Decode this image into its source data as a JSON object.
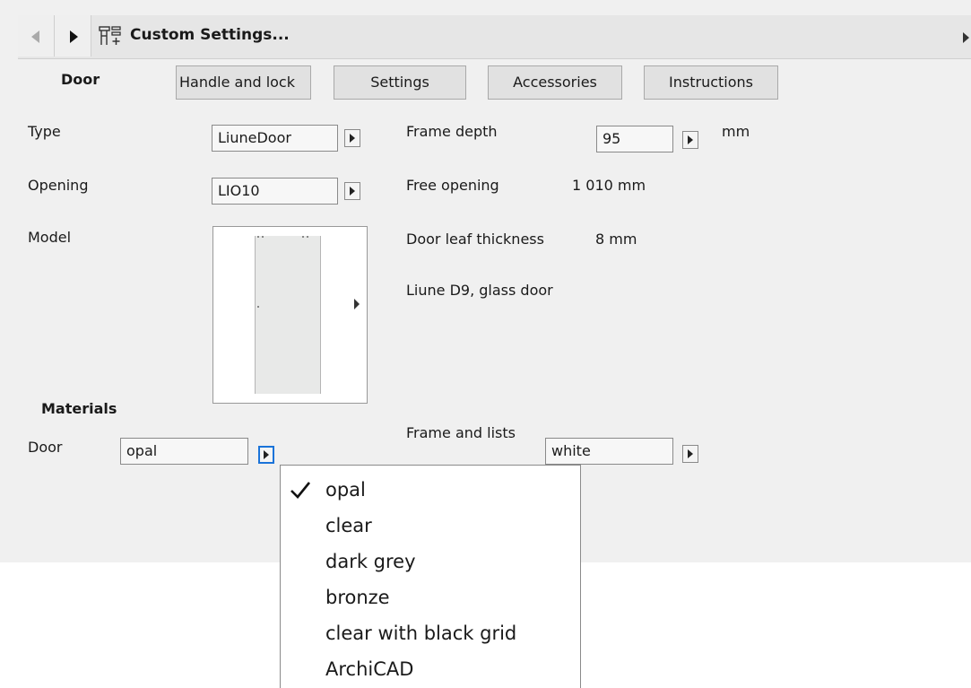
{
  "header": {
    "title": "Custom Settings..."
  },
  "tabs": {
    "active": "Door",
    "items": [
      "Handle and lock",
      "Settings",
      "Accessories",
      "Instructions"
    ]
  },
  "fields": {
    "type_label": "Type",
    "type_value": "LiuneDoor",
    "opening_label": "Opening",
    "opening_value": "LIO10",
    "model_label": "Model",
    "frame_depth_label": "Frame depth",
    "frame_depth_value": "95",
    "frame_depth_unit": "mm",
    "free_opening_label": "Free opening",
    "free_opening_value": "1 010 mm",
    "leaf_thickness_label": "Door leaf thickness",
    "leaf_thickness_value": "8 mm",
    "description": "Liune D9, glass door"
  },
  "materials": {
    "heading": "Materials",
    "door_label": "Door",
    "door_value": "opal",
    "frame_label": "Frame and lists",
    "frame_value": "white"
  },
  "dropdown": {
    "selected": "opal",
    "options": [
      "opal",
      "clear",
      "dark grey",
      "bronze",
      "clear with black grid",
      "ArchiCAD"
    ]
  },
  "icons": {
    "settings_icon": "custom-settings-icon",
    "checkmark": "check-icon"
  }
}
